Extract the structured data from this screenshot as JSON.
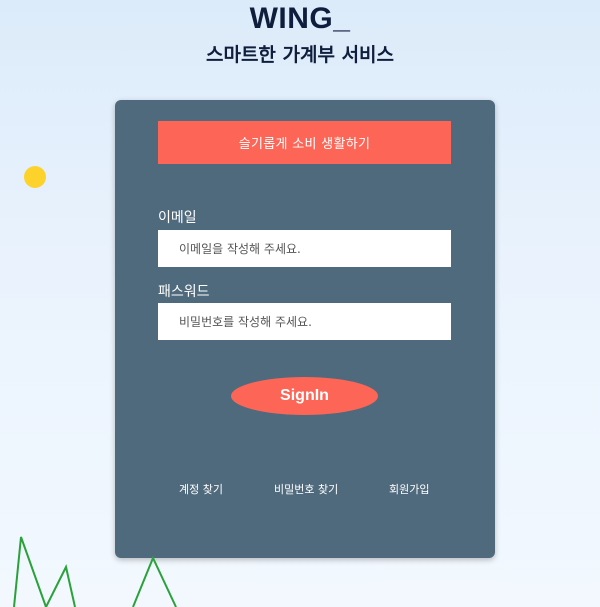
{
  "header": {
    "brand": "WING_",
    "subtitle": "스마트한 가계부 서비스"
  },
  "login_card": {
    "banner": "슬기롭게 소비 생활하기",
    "email": {
      "label": "이메일",
      "placeholder": "이메일을 작성해 주세요.",
      "value": ""
    },
    "password": {
      "label": "패스워드",
      "placeholder": "비밀번호를 작성해 주세요.",
      "value": ""
    },
    "signin_label": "SignIn",
    "links": {
      "find_account": "계정 찾기",
      "find_password": "비밀번호 찾기",
      "signup": "회원가입"
    }
  },
  "colors": {
    "background": "#e6f1fc",
    "card": "#506a7d",
    "accent": "#fd6556",
    "heading": "#0f1e3c",
    "sun": "#fdd32b",
    "mountain_stroke": "#2aa23a"
  },
  "decorations": {
    "sun_icon": "circle",
    "mountains_icon": "zigzag-line"
  }
}
